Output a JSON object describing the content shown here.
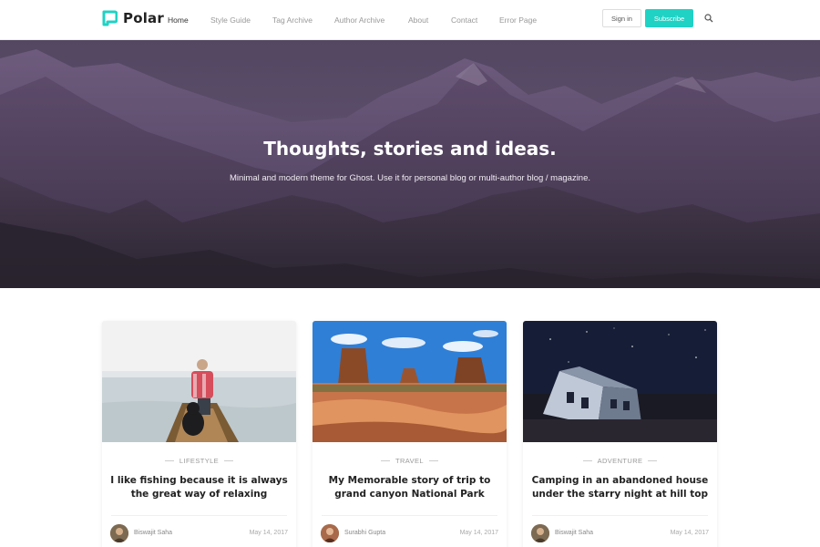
{
  "header": {
    "logo_text": "Polar",
    "nav": [
      "Home",
      "Style Guide",
      "Tag Archive",
      "Author Archive",
      "About",
      "Contact",
      "Error Page"
    ],
    "signin_label": "Sign in",
    "subscribe_label": "Subscribe",
    "search_icon": "search-icon",
    "accent_color": "#1fd2c4"
  },
  "hero": {
    "title": "Thoughts, stories and ideas.",
    "subtitle": "Minimal and modern theme for Ghost. Use it for personal blog or multi-author blog / magazine."
  },
  "posts": [
    {
      "tag": "LIFESTYLE",
      "title": "I like fishing because it is always the great way of relaxing",
      "author": "Biswajit Saha",
      "date": "May 14, 2017"
    },
    {
      "tag": "TRAVEL",
      "title": "My Memorable story of trip to grand canyon National Park",
      "author": "Surabhi Gupta",
      "date": "May 14, 2017"
    },
    {
      "tag": "ADVENTURE",
      "title": "Camping in an abandoned house under the starry night at hill top",
      "author": "Biswajit Saha",
      "date": "May 14, 2017"
    }
  ]
}
